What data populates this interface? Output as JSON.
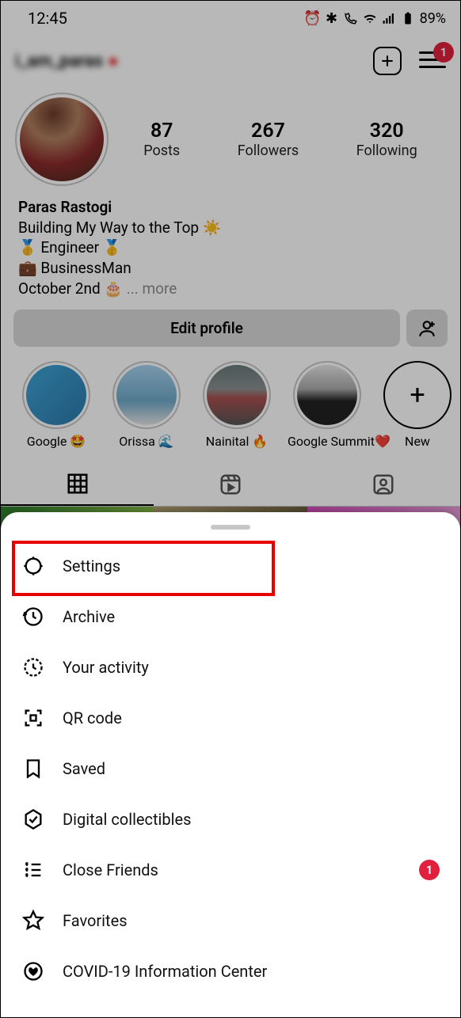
{
  "status": {
    "time": "12:45",
    "battery": "89%"
  },
  "header": {
    "username_blurred": "i_am_paras",
    "hamburger_badge": "1"
  },
  "profile": {
    "stats": [
      {
        "num": "87",
        "lbl": "Posts"
      },
      {
        "num": "267",
        "lbl": "Followers"
      },
      {
        "num": "320",
        "lbl": "Following"
      }
    ],
    "name": "Paras Rastogi",
    "bio_lines": [
      "Building My Way to the Top ☀️",
      "🥇 Engineer 🥇",
      "💼 BusinessMan",
      "October 2nd 🎂"
    ],
    "more": "... more",
    "edit_label": "Edit profile"
  },
  "highlights": [
    {
      "label": "Google 🤩"
    },
    {
      "label": "Orissa 🌊"
    },
    {
      "label": "Nainital 🔥"
    },
    {
      "label": "Google Summit❤️"
    }
  ],
  "highlight_new": "New",
  "menu": [
    {
      "icon": "settings",
      "label": "Settings",
      "highlighted": true
    },
    {
      "icon": "archive",
      "label": "Archive"
    },
    {
      "icon": "activity",
      "label": "Your activity"
    },
    {
      "icon": "qr",
      "label": "QR code"
    },
    {
      "icon": "saved",
      "label": "Saved"
    },
    {
      "icon": "digital",
      "label": "Digital collectibles"
    },
    {
      "icon": "closefriends",
      "label": "Close Friends",
      "badge": "1"
    },
    {
      "icon": "favorites",
      "label": "Favorites"
    },
    {
      "icon": "covid",
      "label": "COVID-19 Information Center"
    }
  ]
}
